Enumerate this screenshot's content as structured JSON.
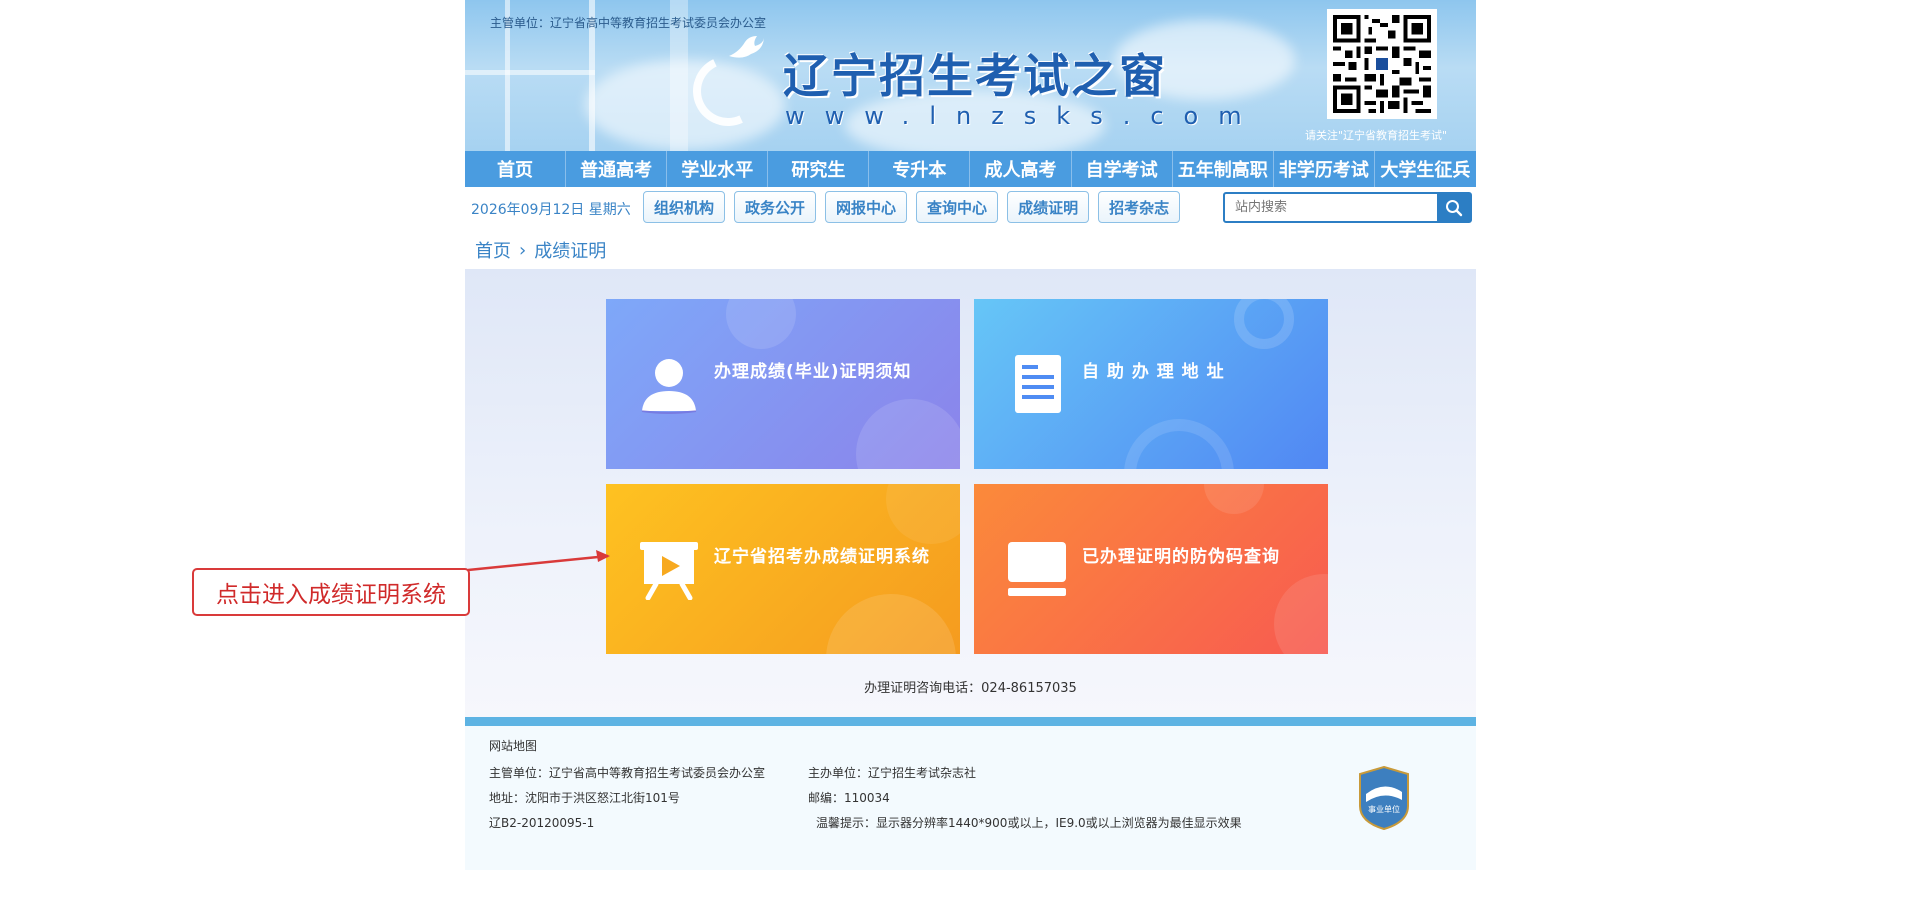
{
  "header": {
    "top_note": "主管单位：辽宁省高中等教育招生考试委员会办公室",
    "site_title": "辽宁招生考试之窗",
    "site_url": "www.lnzsks.com",
    "qr_note": "请关注\"辽宁省教育招生考试\""
  },
  "nav": {
    "items": [
      "首页",
      "普通高考",
      "学业水平",
      "研究生",
      "专升本",
      "成人高考",
      "自学考试",
      "五年制高职",
      "非学历考试",
      "大学生征兵"
    ]
  },
  "subbar": {
    "date": "2026年09月12日 星期六",
    "chips": [
      "组织机构",
      "政务公开",
      "网报中心",
      "查询中心",
      "成绩证明",
      "招考杂志"
    ],
    "search_placeholder": "站内搜索"
  },
  "breadcrumb": {
    "home": "首页",
    "sep": "›",
    "current": "成绩证明"
  },
  "cards": [
    {
      "label": "办理成绩(毕业)证明须知",
      "icon": "user-icon"
    },
    {
      "label": "自 助 办 理 地 址",
      "icon": "document-icon"
    },
    {
      "label": "辽宁省招考办成绩证明系统",
      "icon": "presentation-icon"
    },
    {
      "label": "已办理证明的防伪码查询",
      "icon": "laptop-icon"
    }
  ],
  "phone": "办理证明咨询电话：024-86157035",
  "footer": {
    "sitemap": "网站地图",
    "admin": "主管单位：辽宁省高中等教育招生考试委员会办公室",
    "sponsor": "主办单位：辽宁招生考试杂志社",
    "address": "地址：沈阳市于洪区怒江北街101号",
    "postcode": "邮编：110034",
    "icp": "辽B2-20120095-1",
    "tip": "温馨提示：显示器分辨率1440*900或以上，IE9.0或以上浏览器为最佳显示效果",
    "badge_text": "事业单位"
  },
  "annotation": {
    "text": "点击进入成绩证明系统",
    "color": "#d93a3a"
  },
  "colors": {
    "nav_bg": "#4a9ce0",
    "link": "#3a84c6",
    "footer_bar": "#5db3e3"
  }
}
